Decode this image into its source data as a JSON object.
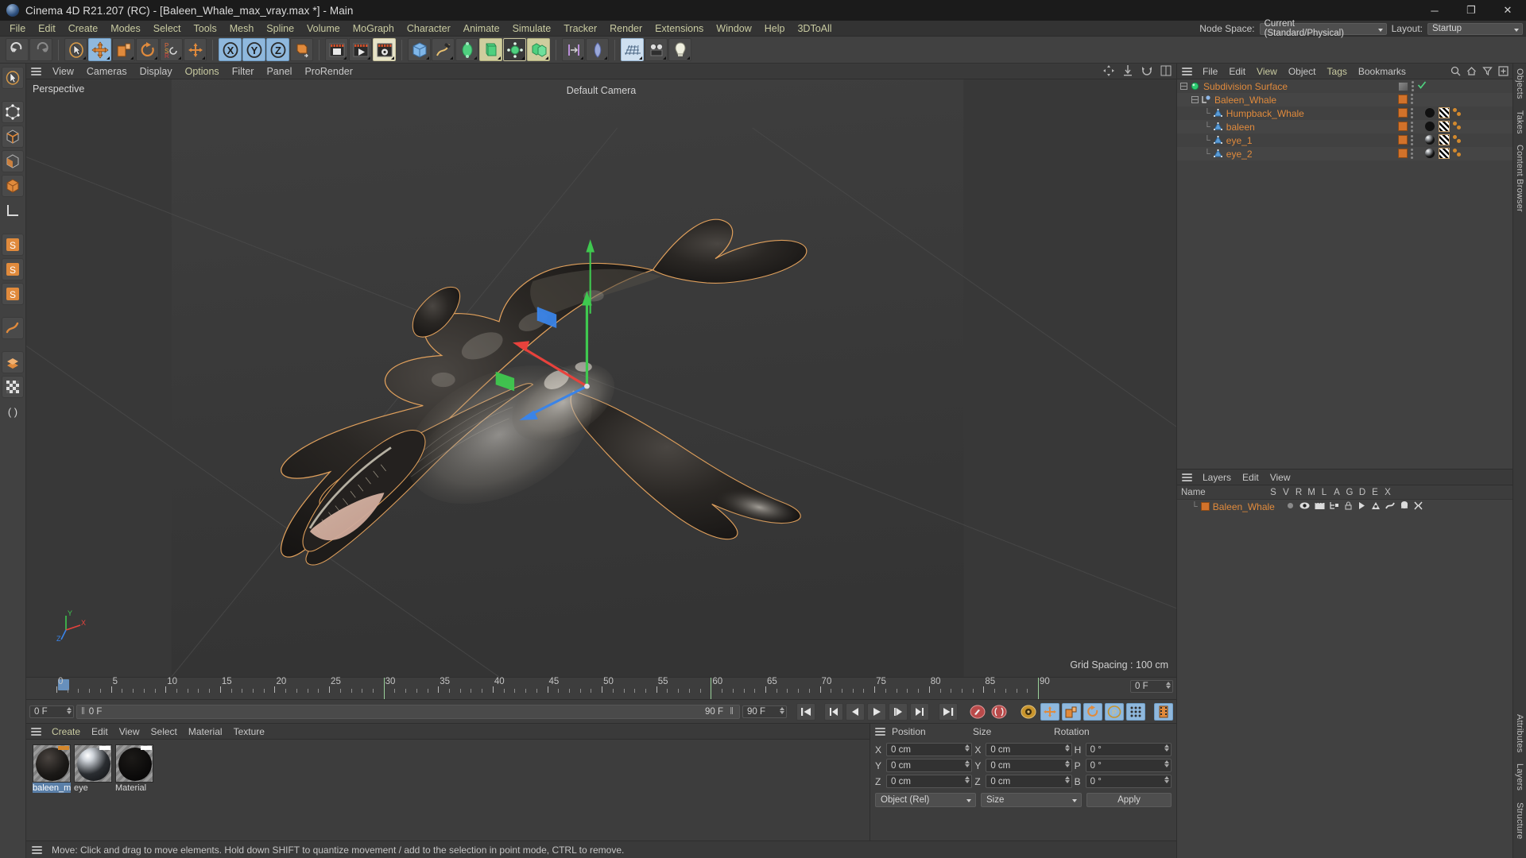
{
  "titlebar": {
    "title": "Cinema 4D R21.207 (RC) - [Baleen_Whale_max_vray.max *] - Main",
    "minimize": "─",
    "maximize": "❐",
    "close": "✕",
    "app_icon": "cinema4d-icon"
  },
  "menubar": {
    "items": [
      "File",
      "Edit",
      "Create",
      "Modes",
      "Select",
      "Tools",
      "Mesh",
      "Spline",
      "Volume",
      "MoGraph",
      "Character",
      "Animate",
      "Simulate",
      "Tracker",
      "Render",
      "Extensions",
      "Window",
      "Help",
      "3DToAll"
    ],
    "node_space_label": "Node Space:",
    "node_space_value": "Current (Standard/Physical)",
    "layout_label": "Layout:",
    "layout_value": "Startup"
  },
  "viewport": {
    "menu": [
      "View",
      "Cameras",
      "Display",
      "Options",
      "Filter",
      "Panel",
      "ProRender"
    ],
    "label": "Perspective",
    "camera": "Default Camera",
    "grid_spacing": "Grid Spacing : 100 cm",
    "axis": {
      "x": "X",
      "y": "Y",
      "z": "Z"
    }
  },
  "timeline": {
    "ticks": [
      0,
      5,
      10,
      15,
      20,
      25,
      30,
      35,
      40,
      45,
      50,
      55,
      60,
      65,
      70,
      75,
      80,
      85,
      90
    ],
    "current_frame_field": "0 F",
    "playhead_frame": "0 F",
    "left_frame": "0 F",
    "end_frame_display": "90 F",
    "end_frame_field": "90 F"
  },
  "materials": {
    "menu": [
      "Create",
      "Edit",
      "View",
      "Select",
      "Material",
      "Texture"
    ],
    "items": [
      {
        "name": "baleen_m",
        "selected": true,
        "tag_color": "#d2862c",
        "ball": "dark"
      },
      {
        "name": "eye",
        "selected": false,
        "tag_color": "#ffffff",
        "ball": "glossy"
      },
      {
        "name": "Material",
        "selected": false,
        "tag_color": "#ffffff",
        "ball": "black"
      }
    ]
  },
  "coordinates": {
    "headers": {
      "position": "Position",
      "size": "Size",
      "rotation": "Rotation"
    },
    "rows": [
      {
        "pl": "X",
        "pv": "0 cm",
        "sl": "X",
        "sv": "0 cm",
        "rl": "H",
        "rv": "0 °"
      },
      {
        "pl": "Y",
        "pv": "0 cm",
        "sl": "Y",
        "sv": "0 cm",
        "rl": "P",
        "rv": "0 °"
      },
      {
        "pl": "Z",
        "pv": "0 cm",
        "sl": "Z",
        "sv": "0 cm",
        "rl": "B",
        "rv": "0 °"
      }
    ],
    "mode_select": "Object (Rel)",
    "size_select": "Size",
    "apply_button": "Apply"
  },
  "objects": {
    "menu": [
      "File",
      "Edit",
      "View",
      "Object",
      "Tags",
      "Bookmarks"
    ],
    "rows": [
      {
        "name": "Subdivision Surface",
        "indent": 0,
        "type": "subdivision",
        "has_expander": true,
        "tags": "subdiv"
      },
      {
        "name": "Baleen_Whale",
        "indent": 1,
        "type": "null",
        "has_expander": true,
        "tags": "layer"
      },
      {
        "name": "Humpback_Whale",
        "indent": 2,
        "type": "polygon",
        "has_expander": false,
        "tags": "full"
      },
      {
        "name": "baleen",
        "indent": 2,
        "type": "polygon",
        "has_expander": false,
        "tags": "full"
      },
      {
        "name": "eye_1",
        "indent": 2,
        "type": "polygon",
        "has_expander": false,
        "tags": "full"
      },
      {
        "name": "eye_2",
        "indent": 2,
        "type": "polygon",
        "has_expander": false,
        "tags": "full"
      }
    ]
  },
  "layers": {
    "menu": [
      "Layers",
      "Edit",
      "View"
    ],
    "columns": [
      "Name",
      "S",
      "V",
      "R",
      "M",
      "L",
      "A",
      "G",
      "D",
      "E",
      "X"
    ],
    "rows": [
      {
        "name": "Baleen_Whale",
        "color": "#d2722a"
      }
    ]
  },
  "edge_tabs_top": [
    "Objects",
    "Takes",
    "Content Browser"
  ],
  "edge_tabs_bottom": [
    "Attributes",
    "Layers",
    "Structure"
  ],
  "statusbar": {
    "text": "Move: Click and drag to move elements. Hold down SHIFT to quantize movement / add to the selection in point mode, CTRL to remove."
  },
  "colors": {
    "accent_orange": "#e08a3c",
    "menu_yellow": "#c9cba1",
    "selection_blue": "#8fb8dd",
    "panel_bg": "#414141",
    "dark_bg": "#1b1b1b"
  }
}
